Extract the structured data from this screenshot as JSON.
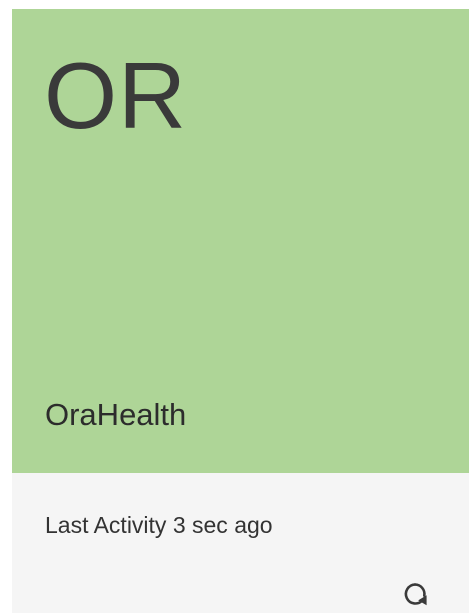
{
  "card": {
    "initials": "OR",
    "app_name": "OraHealth",
    "last_activity": "Last Activity 3 sec ago",
    "refresh_icon": "refresh-icon",
    "tile_color": "#aed597",
    "footer_color": "#f5f5f5"
  }
}
